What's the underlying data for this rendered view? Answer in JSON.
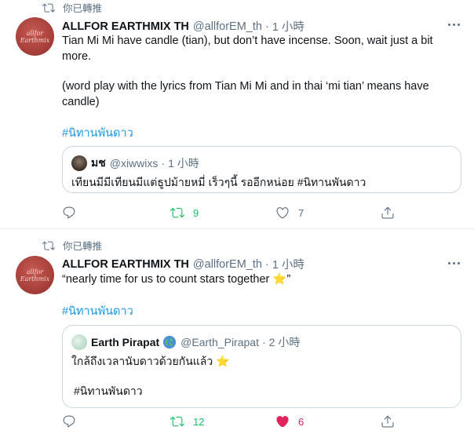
{
  "tweets": [
    {
      "retweet_label": "你已轉推",
      "author_name": "ALLFOR EARTHMIX TH",
      "handle": "@allforEM_th",
      "dot": "·",
      "time": "1 小時",
      "text_line1": "Tian Mi Mi have candle (tian), but don’t have incense. Soon, wait just a bit more.",
      "text_line2": "(word play with the lyrics from Tian Mi Mi and in thai ‘mi tian’ means have candle)",
      "hashtag": "#นิทานพันดาว",
      "quote": {
        "name": "มช",
        "handle": "@xiwwixs",
        "dot": "·",
        "time": "1 小時",
        "text": "เทียนมีมีเทียนมีแต่ธูปม้ายหมี่ เร็วๆนี้ รออีกหน่อย #นิทานพันดาว"
      },
      "replies": "",
      "retweets": "9",
      "likes": "7",
      "retweeted": true,
      "liked": false
    },
    {
      "retweet_label": "你已轉推",
      "author_name": "ALLFOR EARTHMIX TH",
      "handle": "@allforEM_th",
      "dot": "·",
      "time": "1 小時",
      "text_line1": "“nearly time for us to count stars together ⭐”",
      "hashtag": "#นิทานพันดาว",
      "quote": {
        "name": "Earth Pirapat",
        "handle": "@Earth_Pirapat",
        "dot": "·",
        "time": "2 小時",
        "text": "ใกล้ถึงเวลานับดาวด้วยกันแล้ว ⭐",
        "text2": "#นิทานพันดาว"
      },
      "replies": "",
      "retweets": "12",
      "likes": "6",
      "retweeted": true,
      "liked": true
    }
  ],
  "colors": {
    "retweet_active": "#17bf63",
    "like_active": "#e0245e",
    "hashtag": "#1b95e0",
    "muted": "#5b7083"
  },
  "icons": [
    "retweet-icon",
    "more-icon",
    "reply-icon",
    "like-icon",
    "share-icon",
    "verified-globe-icon"
  ]
}
